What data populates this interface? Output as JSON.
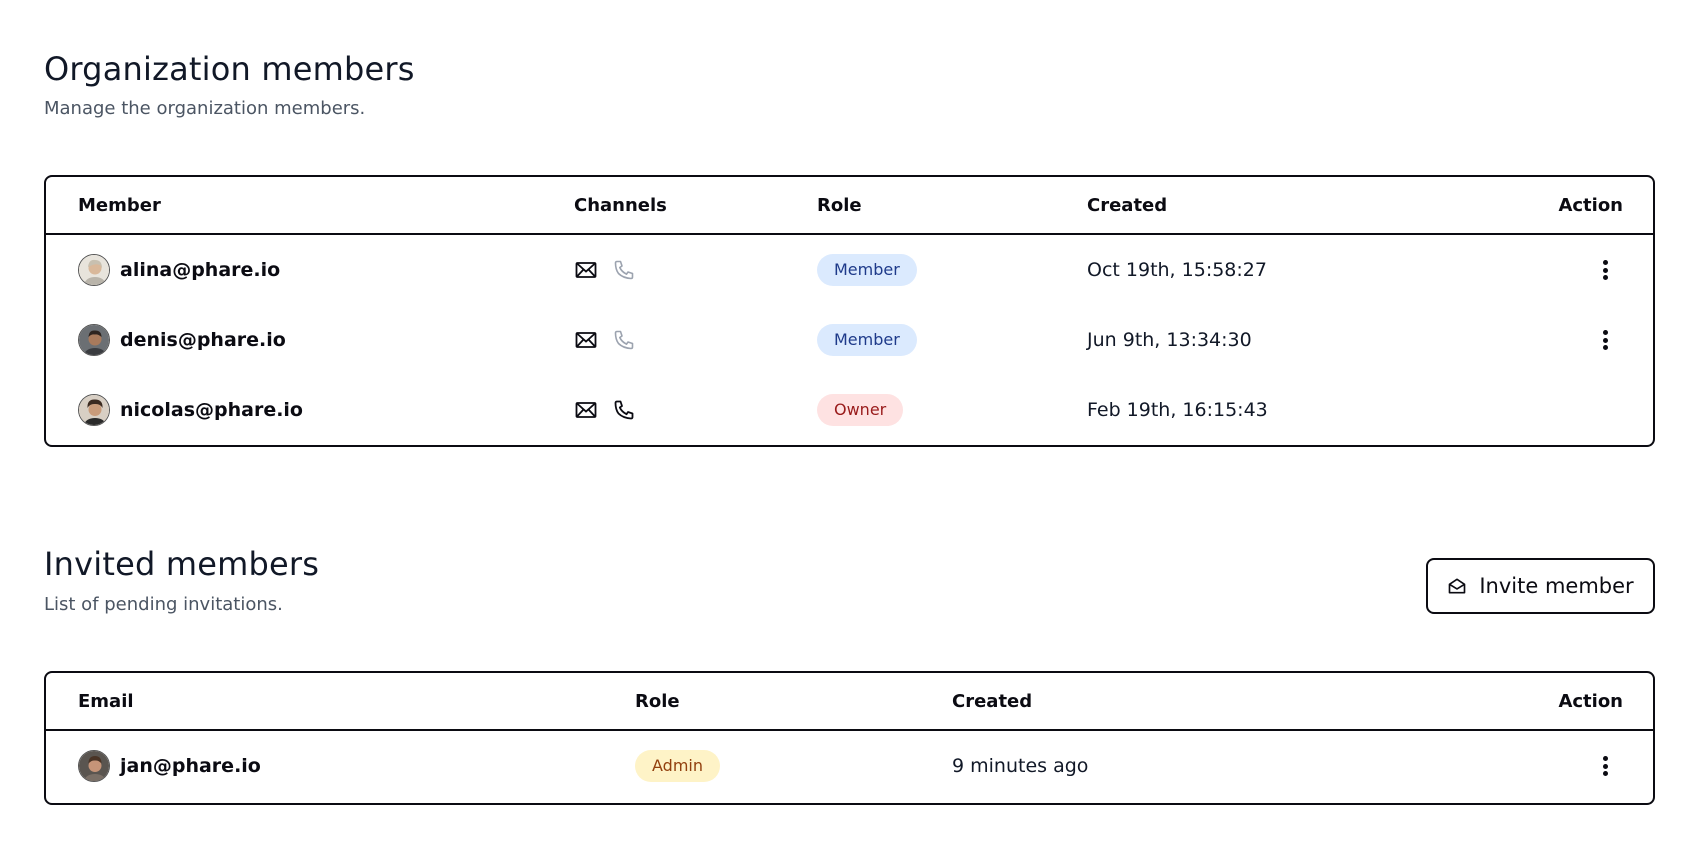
{
  "org_section": {
    "title": "Organization members",
    "description": "Manage the organization members."
  },
  "members_table": {
    "columns": {
      "member": "Member",
      "channels": "Channels",
      "role": "Role",
      "created": "Created",
      "action": "Action"
    },
    "rows": [
      {
        "email": "alina@phare.io",
        "role": "Member",
        "created": "Oct 19th, 15:58:27",
        "email_channel": true,
        "phone_channel": false,
        "has_action": true
      },
      {
        "email": "denis@phare.io",
        "role": "Member",
        "created": "Jun 9th, 13:34:30",
        "email_channel": true,
        "phone_channel": false,
        "has_action": true
      },
      {
        "email": "nicolas@phare.io",
        "role": "Owner",
        "created": "Feb 19th, 16:15:43",
        "email_channel": true,
        "phone_channel": true,
        "has_action": false
      }
    ]
  },
  "invited_section": {
    "title": "Invited members",
    "description": "List of pending invitations.",
    "invite_button": "Invite member"
  },
  "invites_table": {
    "columns": {
      "email": "Email",
      "role": "Role",
      "created": "Created",
      "action": "Action"
    },
    "rows": [
      {
        "email": "jan@phare.io",
        "role": "Admin",
        "created": "9 minutes ago",
        "has_action": true
      }
    ]
  },
  "icons": {
    "email_channel": "mail-icon",
    "phone_channel": "phone-icon",
    "row_action": "more-vertical-icon",
    "invite": "envelope-open-icon"
  },
  "colors": {
    "border": "#0b0b12",
    "badge_member_bg": "#dbeafe",
    "badge_member_text": "#1e3a8a",
    "badge_owner_bg": "#fee2e2",
    "badge_owner_text": "#991b1b",
    "badge_admin_bg": "#fef3c7",
    "badge_admin_text": "#92400e",
    "channel_inactive": "#9ca3af"
  }
}
